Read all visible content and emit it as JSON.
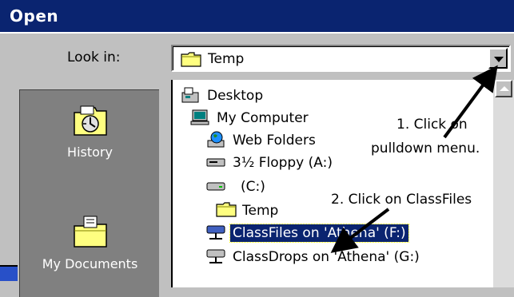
{
  "window": {
    "title": "Open"
  },
  "lookin": {
    "label": "Look in:",
    "current": "Temp"
  },
  "places": [
    {
      "label": "History",
      "icon": "history-folder-icon"
    },
    {
      "label": "My Documents",
      "icon": "my-documents-folder-icon"
    }
  ],
  "tree": [
    {
      "label": "Desktop",
      "icon": "desktop-icon",
      "indent": 0
    },
    {
      "label": "My Computer",
      "icon": "computer-icon",
      "indent": 1
    },
    {
      "label": "Web Folders",
      "icon": "web-folders-icon",
      "indent": 2
    },
    {
      "label": "3½ Floppy (A:)",
      "icon": "floppy-drive-icon",
      "indent": 2
    },
    {
      "label": "(C:)",
      "icon": "hard-drive-icon",
      "indent": 2
    },
    {
      "label": "Temp",
      "icon": "folder-icon",
      "indent": 3
    },
    {
      "label": "ClassFiles on 'Athena' (F:)",
      "icon": "network-drive-icon",
      "indent": 2,
      "selected": true
    },
    {
      "label": "ClassDrops on 'Athena' (G:)",
      "icon": "network-drive-icon",
      "indent": 2
    }
  ],
  "annotations": {
    "step1_line1": "1. Click on",
    "step1_line2": "pulldown menu.",
    "step2": "2. Click on ClassFiles"
  },
  "colors": {
    "titlebar": "#0a2470",
    "selection": "#0a2470",
    "places_bar": "#808080",
    "dialog": "#c0c0c0"
  }
}
